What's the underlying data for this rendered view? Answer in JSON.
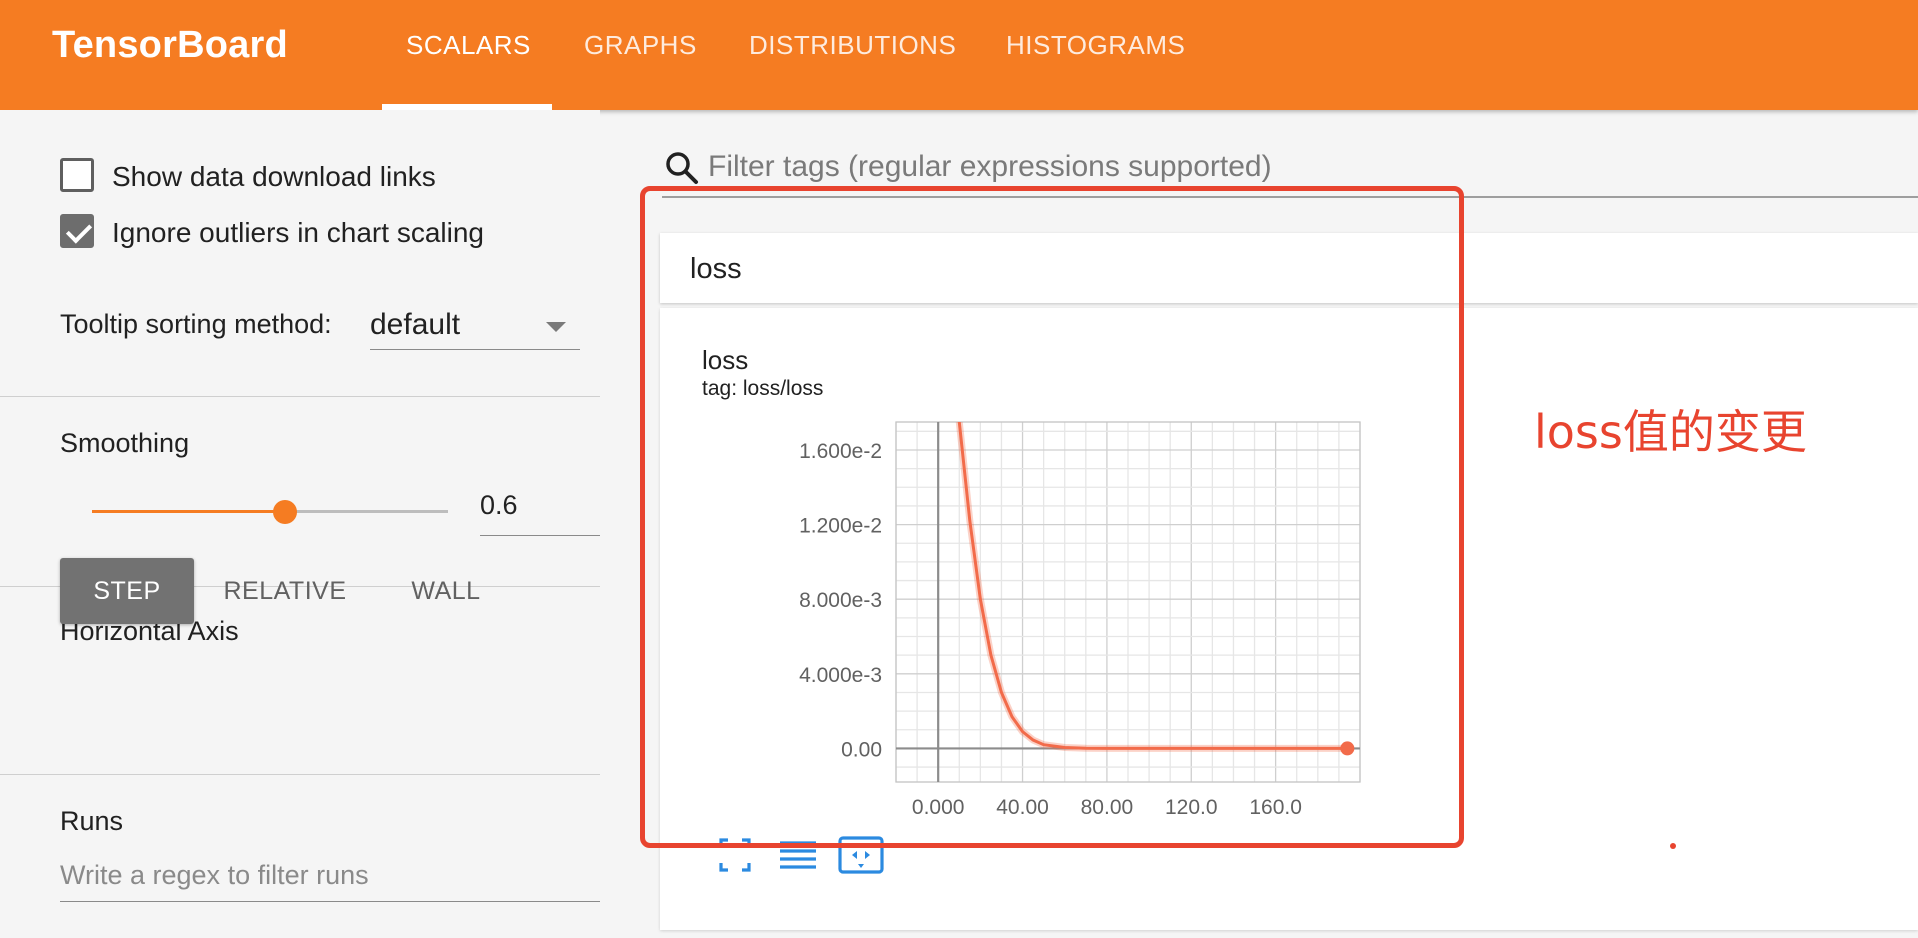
{
  "app": {
    "title": "TensorBoard",
    "tabs": [
      {
        "label": "SCALARS",
        "active": true
      },
      {
        "label": "GRAPHS",
        "active": false
      },
      {
        "label": "DISTRIBUTIONS",
        "active": false
      },
      {
        "label": "HISTOGRAMS",
        "active": false
      }
    ],
    "accent_color": "#f57c22"
  },
  "sidebar": {
    "show_download_links": {
      "label": "Show data download links",
      "checked": false
    },
    "ignore_outliers": {
      "label": "Ignore outliers in chart scaling",
      "checked": true
    },
    "tooltip_sorting": {
      "label": "Tooltip sorting method:",
      "value": "default"
    },
    "smoothing": {
      "label": "Smoothing",
      "value": "0.6",
      "fraction": 0.6
    },
    "horizontal_axis": {
      "label": "Horizontal Axis",
      "options": [
        {
          "label": "STEP",
          "active": true
        },
        {
          "label": "RELATIVE",
          "active": false
        },
        {
          "label": "WALL",
          "active": false
        }
      ]
    },
    "runs": {
      "label": "Runs",
      "placeholder": "Write a regex to filter runs"
    }
  },
  "main": {
    "search_placeholder": "Filter tags (regular expressions supported)",
    "card_title": "loss",
    "chart_title": "loss",
    "chart_tag": "tag: loss/loss",
    "annotation_text": "loss值的变更",
    "annotation_color": "#e8442f",
    "tool_icons": [
      "fit-to-data-icon",
      "data-list-icon",
      "expand-chart-icon"
    ]
  },
  "chart_data": {
    "type": "line",
    "title": "loss",
    "subtitle": "tag: loss/loss",
    "xlabel": "",
    "ylabel": "",
    "xlim": [
      -20,
      200
    ],
    "ylim": [
      -0.0018,
      0.0175
    ],
    "x_ticks": [
      0,
      40,
      80,
      120,
      160
    ],
    "x_tick_labels": [
      "0.000",
      "40.00",
      "80.00",
      "120.0",
      "160.0"
    ],
    "y_ticks": [
      0,
      0.004,
      0.008,
      0.012,
      0.016
    ],
    "y_tick_labels": [
      "0.00",
      "4.000e-3",
      "8.000e-3",
      "1.200e-2",
      "1.600e-2"
    ],
    "grid": true,
    "series": [
      {
        "color": "#f26b4a",
        "x": [
          0,
          10,
          15,
          20,
          25,
          30,
          35,
          40,
          45,
          50,
          60,
          70,
          80,
          100,
          120,
          140,
          160,
          180,
          194
        ],
        "values": [
          0.05,
          0.0175,
          0.0122,
          0.008,
          0.005,
          0.003,
          0.0017,
          0.0009,
          0.00045,
          0.0002,
          5e-05,
          1e-05,
          0.0,
          0.0,
          0.0,
          0.0,
          0.0,
          0.0,
          0.0
        ]
      }
    ]
  }
}
